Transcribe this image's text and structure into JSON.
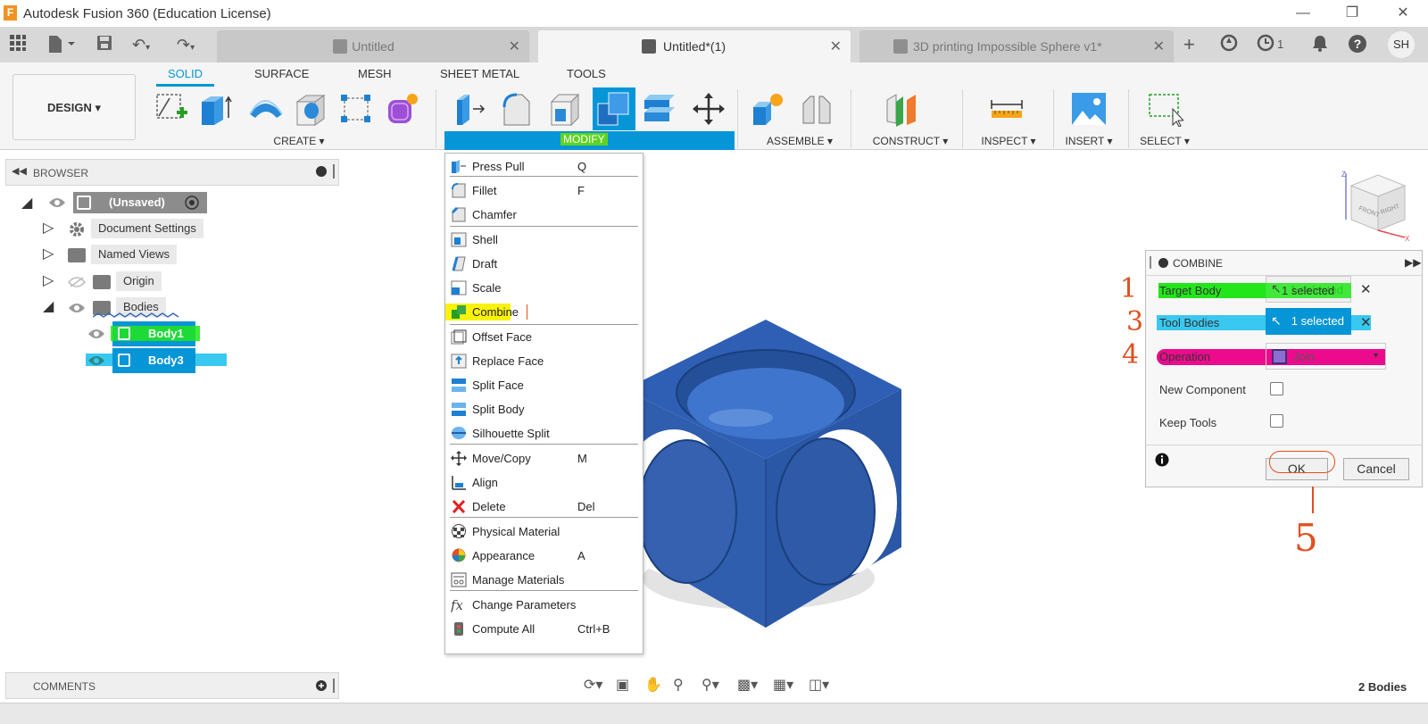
{
  "window": {
    "logo_letter": "F",
    "title": "Autodesk Fusion 360 (Education License)"
  },
  "tabs": [
    {
      "label": "Untitled",
      "active": false
    },
    {
      "label": "Untitled*(1)",
      "active": true
    },
    {
      "label": "3D printing Impossible Sphere v1*",
      "active": false
    }
  ],
  "topbar": {
    "job_count": "1",
    "user_initials": "SH"
  },
  "ribbon": {
    "workspace": "DESIGN",
    "tabs": [
      "SOLID",
      "SURFACE",
      "MESH",
      "SHEET METAL",
      "TOOLS"
    ],
    "active_tab": "SOLID",
    "groups": {
      "create": "CREATE",
      "modify": "MODIFY",
      "assemble": "ASSEMBLE",
      "construct": "CONSTRUCT",
      "inspect": "INSPECT",
      "insert": "INSERT",
      "select": "SELECT"
    }
  },
  "browser": {
    "title": "BROWSER",
    "root": "(Unsaved)",
    "items": [
      "Document Settings",
      "Named Views",
      "Origin",
      "Bodies"
    ],
    "bodies": [
      "Body1",
      "Body3"
    ]
  },
  "modify_menu": {
    "items": [
      {
        "label": "Press Pull",
        "key": "Q"
      },
      {
        "label": "Fillet",
        "key": "F"
      },
      {
        "label": "Chamfer",
        "key": ""
      },
      {
        "label": "Shell",
        "key": ""
      },
      {
        "label": "Draft",
        "key": ""
      },
      {
        "label": "Scale",
        "key": ""
      },
      {
        "label": "Combine",
        "key": ""
      },
      {
        "label": "Offset Face",
        "key": ""
      },
      {
        "label": "Replace Face",
        "key": ""
      },
      {
        "label": "Split Face",
        "key": ""
      },
      {
        "label": "Split Body",
        "key": ""
      },
      {
        "label": "Silhouette Split",
        "key": ""
      },
      {
        "label": "Move/Copy",
        "key": "M"
      },
      {
        "label": "Align",
        "key": ""
      },
      {
        "label": "Delete",
        "key": "Del"
      },
      {
        "label": "Physical Material",
        "key": ""
      },
      {
        "label": "Appearance",
        "key": "A"
      },
      {
        "label": "Manage Materials",
        "key": ""
      },
      {
        "label": "Change Parameters",
        "key": ""
      },
      {
        "label": "Compute All",
        "key": "Ctrl+B"
      }
    ]
  },
  "combine_dialog": {
    "title": "COMBINE",
    "target_body_label": "Target Body",
    "target_body_value": "1 selected",
    "tool_bodies_label": "Tool Bodies",
    "tool_bodies_value": "1 selected",
    "operation_label": "Operation",
    "operation_value": "Join",
    "new_component_label": "New Component",
    "new_component_checked": false,
    "keep_tools_label": "Keep Tools",
    "keep_tools_checked": false,
    "ok_label": "OK",
    "cancel_label": "Cancel"
  },
  "annotations": {
    "step1": "1",
    "step3": "3",
    "step4": "4",
    "step5": "5"
  },
  "viewcube": {
    "front": "FRONT",
    "right": "RIGHT",
    "axis_z": "Z",
    "axis_x": "X"
  },
  "bottom": {
    "comments": "COMMENTS",
    "body_count": "2 Bodies"
  },
  "colors": {
    "accent": "#0696d7",
    "model": "#2e5fb4",
    "highlight_green": "#22e61a",
    "highlight_cyan": "#39c8f0",
    "highlight_magenta": "#ec0b8c",
    "highlight_yellow": "#f8f20c",
    "annotation_red": "#e05020"
  }
}
